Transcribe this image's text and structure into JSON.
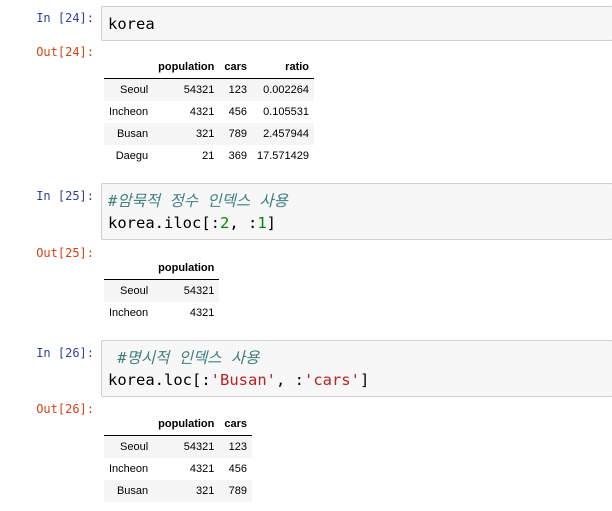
{
  "cells": [
    {
      "in_prompt": "In [24]:",
      "code": [
        [
          {
            "t": "korea",
            "c": ""
          }
        ]
      ],
      "out_prompt": "Out[24]:",
      "table": {
        "columns": [
          "",
          "population",
          "cars",
          "ratio"
        ],
        "rows": [
          [
            "Seoul",
            "54321",
            "123",
            "0.002264"
          ],
          [
            "Incheon",
            "4321",
            "456",
            "0.105531"
          ],
          [
            "Busan",
            "321",
            "789",
            "2.457944"
          ],
          [
            "Daegu",
            "21",
            "369",
            "17.571429"
          ]
        ]
      }
    },
    {
      "in_prompt": "In [25]:",
      "code": [
        [
          {
            "t": "#암묵적 정수 인덱스 사용",
            "c": "cm"
          }
        ],
        [
          {
            "t": "korea.iloc[:",
            "c": ""
          },
          {
            "t": "2",
            "c": "num"
          },
          {
            "t": ", :",
            "c": ""
          },
          {
            "t": "1",
            "c": "num"
          },
          {
            "t": "]",
            "c": ""
          }
        ]
      ],
      "out_prompt": "Out[25]:",
      "table": {
        "columns": [
          "",
          "population"
        ],
        "rows": [
          [
            "Seoul",
            "54321"
          ],
          [
            "Incheon",
            "4321"
          ]
        ]
      }
    },
    {
      "in_prompt": "In [26]:",
      "code": [
        [
          {
            "t": " #명시적 인덱스 사용",
            "c": "cm"
          }
        ],
        [
          {
            "t": "korea.loc[:",
            "c": ""
          },
          {
            "t": "'Busan'",
            "c": "str"
          },
          {
            "t": ", :",
            "c": ""
          },
          {
            "t": "'cars'",
            "c": "str"
          },
          {
            "t": "]",
            "c": ""
          }
        ]
      ],
      "out_prompt": "Out[26]:",
      "table": {
        "columns": [
          "",
          "population",
          "cars"
        ],
        "rows": [
          [
            "Seoul",
            "54321",
            "123"
          ],
          [
            "Incheon",
            "4321",
            "456"
          ],
          [
            "Busan",
            "321",
            "789"
          ]
        ]
      }
    }
  ]
}
